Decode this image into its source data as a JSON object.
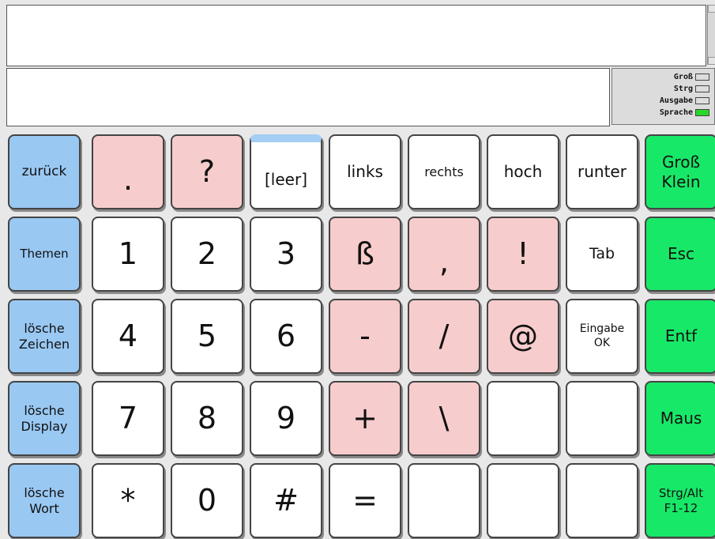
{
  "display": {
    "text": ""
  },
  "input": {
    "text": ""
  },
  "status": [
    {
      "label": "Groß",
      "on": false
    },
    {
      "label": "Strg",
      "on": false
    },
    {
      "label": "Ausgabe",
      "on": false
    },
    {
      "label": "Sprache",
      "on": true
    }
  ],
  "colors": {
    "blue": "#99c8f3",
    "pink": "#f7cccc",
    "white": "#ffffff",
    "green": "#18e868",
    "led_on": "#28d828"
  },
  "keys": [
    [
      {
        "label": "zurück",
        "color": "blue"
      },
      {
        "label": ".",
        "color": "pink"
      },
      {
        "label": "?",
        "color": "pink"
      },
      {
        "label": "[leer]",
        "color": "white",
        "selected": true
      },
      {
        "label": "links",
        "color": "white"
      },
      {
        "label": "rechts",
        "color": "white"
      },
      {
        "label": "hoch",
        "color": "white"
      },
      {
        "label": "runter",
        "color": "white"
      },
      {
        "label": "Groß\nKlein",
        "color": "green"
      }
    ],
    [
      {
        "label": "Themen",
        "color": "blue"
      },
      {
        "label": "1",
        "color": "white"
      },
      {
        "label": "2",
        "color": "white"
      },
      {
        "label": "3",
        "color": "white"
      },
      {
        "label": "ß",
        "color": "pink"
      },
      {
        "label": ",",
        "color": "pink"
      },
      {
        "label": "!",
        "color": "pink"
      },
      {
        "label": "Tab",
        "color": "white"
      },
      {
        "label": "Esc",
        "color": "green"
      }
    ],
    [
      {
        "label": "lösche\nZeichen",
        "color": "blue"
      },
      {
        "label": "4",
        "color": "white"
      },
      {
        "label": "5",
        "color": "white"
      },
      {
        "label": "6",
        "color": "white"
      },
      {
        "label": "-",
        "color": "pink"
      },
      {
        "label": "/",
        "color": "pink"
      },
      {
        "label": "@",
        "color": "pink"
      },
      {
        "label": "Eingabe\nOK",
        "color": "white"
      },
      {
        "label": "Entf",
        "color": "green"
      }
    ],
    [
      {
        "label": "lösche\nDisplay",
        "color": "blue"
      },
      {
        "label": "7",
        "color": "white"
      },
      {
        "label": "8",
        "color": "white"
      },
      {
        "label": "9",
        "color": "white"
      },
      {
        "label": "+",
        "color": "pink"
      },
      {
        "label": "\\",
        "color": "pink"
      },
      {
        "label": "",
        "color": "white"
      },
      {
        "label": "",
        "color": "white"
      },
      {
        "label": "Maus",
        "color": "green"
      }
    ],
    [
      {
        "label": "lösche\nWort",
        "color": "blue"
      },
      {
        "label": "*",
        "color": "white"
      },
      {
        "label": "0",
        "color": "white"
      },
      {
        "label": "#",
        "color": "white"
      },
      {
        "label": "=",
        "color": "white"
      },
      {
        "label": "",
        "color": "white"
      },
      {
        "label": "",
        "color": "white"
      },
      {
        "label": "",
        "color": "white"
      },
      {
        "label": "Strg/Alt\nF1-12",
        "color": "green"
      }
    ]
  ]
}
